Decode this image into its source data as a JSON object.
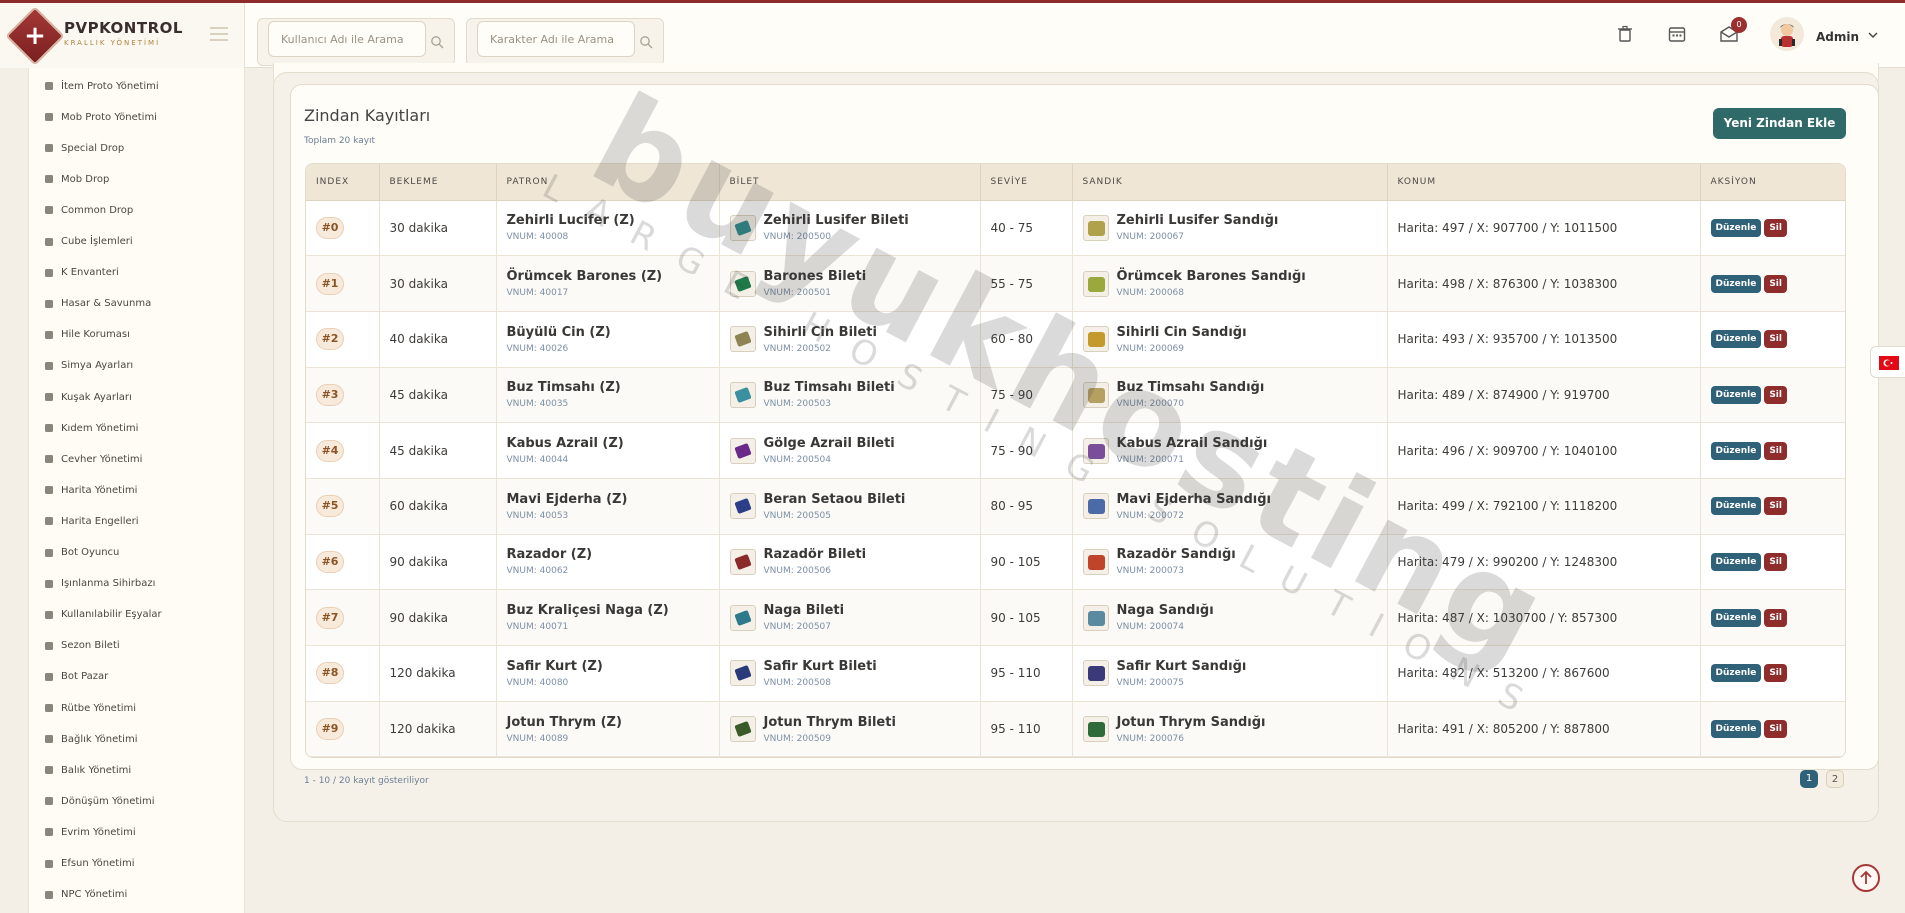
{
  "brand": {
    "name": "PVPKONTROL",
    "subtitle": "KRALLIK YÖNETİMİ",
    "logo_glyph": "+"
  },
  "header": {
    "search_user_placeholder": "Kullanıcı Adı ile Arama",
    "search_char_placeholder": "Karakter Adı ile Arama",
    "notification_count": "0",
    "user_name": "Admin"
  },
  "sidebar": {
    "items": [
      {
        "label": "İtem Proto Yönetimi",
        "icon": "box-icon"
      },
      {
        "label": "Mob Proto Yönetimi",
        "icon": "paw-icon"
      },
      {
        "label": "Special Drop",
        "icon": "gift-icon"
      },
      {
        "label": "Mob Drop",
        "icon": "bug-icon"
      },
      {
        "label": "Common Drop",
        "icon": "box-icon"
      },
      {
        "label": "Cube İşlemleri",
        "icon": "cube-icon"
      },
      {
        "label": "K Envanteri",
        "icon": "box-icon"
      },
      {
        "label": "Hasar & Savunma",
        "icon": "scale-icon"
      },
      {
        "label": "Hile Koruması",
        "icon": "shield-icon"
      },
      {
        "label": "Simya Ayarları",
        "icon": "gem-icon"
      },
      {
        "label": "Kuşak Ayarları",
        "icon": "sliders-icon"
      },
      {
        "label": "Kıdem Yönetimi",
        "icon": "star-icon"
      },
      {
        "label": "Cevher Yönetimi",
        "icon": "gem-icon"
      },
      {
        "label": "Harita Yönetimi",
        "icon": "map-icon"
      },
      {
        "label": "Harita Engelleri",
        "icon": "ban-icon"
      },
      {
        "label": "Bot Oyuncu",
        "icon": "robot-icon"
      },
      {
        "label": "Işınlanma Sihirbazı",
        "icon": "magic-icon"
      },
      {
        "label": "Kullanılabilir Eşyalar",
        "icon": "basket-icon"
      },
      {
        "label": "Sezon Bileti",
        "icon": "trophy-icon"
      },
      {
        "label": "Bot Pazar",
        "icon": "shop-icon"
      },
      {
        "label": "Rütbe Yönetimi",
        "icon": "star-icon"
      },
      {
        "label": "Bağlık Yönetimi",
        "icon": "h-icon"
      },
      {
        "label": "Balık Yönetimi",
        "icon": "anchor-icon"
      },
      {
        "label": "Dönüşüm Yönetimi",
        "icon": "shuffle-icon"
      },
      {
        "label": "Evrim Yönetimi",
        "icon": "wand-icon"
      },
      {
        "label": "Efsun Yönetimi",
        "icon": "wand-icon"
      },
      {
        "label": "NPC Yönetimi",
        "icon": "building-icon"
      }
    ]
  },
  "main": {
    "title": "Zindan Kayıtları",
    "subtitle": "Toplam 20 kayıt",
    "add_button": "Yeni Zindan Ekle",
    "footer": "1 - 10 / 20 kayıt gösteriliyor",
    "pages": [
      "1",
      "2"
    ],
    "edit_label": "Düzenle",
    "delete_label": "Sil",
    "columns": [
      "INDEX",
      "BEKLEME",
      "PATRON",
      "BİLET",
      "SEVİYE",
      "SANDIK",
      "KONUM",
      "AKSİYON"
    ],
    "rows": [
      {
        "index": "#0",
        "wait": "30 dakika",
        "boss": "Zehirli Lucifer (Z)",
        "boss_vnum": "VNUM: 40008",
        "ticket": "Zehirli Lusifer Bileti",
        "ticket_vnum": "VNUM: 200500",
        "level": "40 - 75",
        "chest": "Zehirli Lusifer Sandığı",
        "chest_vnum": "VNUM: 200067",
        "location": "Harita: 497 / X: 907700 / Y: 1011500",
        "ticket_color": "#2e8b8b",
        "chest_color": "#b0a24a"
      },
      {
        "index": "#1",
        "wait": "30 dakika",
        "boss": "Örümcek Barones (Z)",
        "boss_vnum": "VNUM: 40017",
        "ticket": "Barones Bileti",
        "ticket_vnum": "VNUM: 200501",
        "level": "55 - 75",
        "chest": "Örümcek Barones Sandığı",
        "chest_vnum": "VNUM: 200068",
        "location": "Harita: 498 / X: 876300 / Y: 1038300",
        "ticket_color": "#1f7a4a",
        "chest_color": "#9aa83c"
      },
      {
        "index": "#2",
        "wait": "40 dakika",
        "boss": "Büyülü Cin (Z)",
        "boss_vnum": "VNUM: 40026",
        "ticket": "Sihirli Cin Bileti",
        "ticket_vnum": "VNUM: 200502",
        "level": "60 - 80",
        "chest": "Sihirli Cin Sandığı",
        "chest_vnum": "VNUM: 200069",
        "location": "Harita: 493 / X: 935700 / Y: 1013500",
        "ticket_color": "#8e8352",
        "chest_color": "#c49a2c"
      },
      {
        "index": "#3",
        "wait": "45 dakika",
        "boss": "Buz Timsahı (Z)",
        "boss_vnum": "VNUM: 40035",
        "ticket": "Buz Timsahı Bileti",
        "ticket_vnum": "VNUM: 200503",
        "level": "75 - 90",
        "chest": "Buz Timsahı Sandığı",
        "chest_vnum": "VNUM: 200070",
        "location": "Harita: 489 / X: 874900 / Y: 919700",
        "ticket_color": "#3a8fa0",
        "chest_color": "#b5a060"
      },
      {
        "index": "#4",
        "wait": "45 dakika",
        "boss": "Kabus Azrail (Z)",
        "boss_vnum": "VNUM: 40044",
        "ticket": "Gölge Azrail Bileti",
        "ticket_vnum": "VNUM: 200504",
        "level": "75 - 90",
        "chest": "Kabus Azrail Sandığı",
        "chest_vnum": "VNUM: 200071",
        "location": "Harita: 496 / X: 909700 / Y: 1040100",
        "ticket_color": "#6a2a8a",
        "chest_color": "#7a4e9a"
      },
      {
        "index": "#5",
        "wait": "60 dakika",
        "boss": "Mavi Ejderha (Z)",
        "boss_vnum": "VNUM: 40053",
        "ticket": "Beran Setaou Bileti",
        "ticket_vnum": "VNUM: 200505",
        "level": "80 - 95",
        "chest": "Mavi Ejderha Sandığı",
        "chest_vnum": "VNUM: 200072",
        "location": "Harita: 499 / X: 792100 / Y: 1118200",
        "ticket_color": "#2c3e8a",
        "chest_color": "#4a6aa8"
      },
      {
        "index": "#6",
        "wait": "90 dakika",
        "boss": "Razador (Z)",
        "boss_vnum": "VNUM: 40062",
        "ticket": "Razadör Bileti",
        "ticket_vnum": "VNUM: 200506",
        "level": "90 - 105",
        "chest": "Razadör Sandığı",
        "chest_vnum": "VNUM: 200073",
        "location": "Harita: 479 / X: 990200 / Y: 1248300",
        "ticket_color": "#8a2a2a",
        "chest_color": "#c0442a"
      },
      {
        "index": "#7",
        "wait": "90 dakika",
        "boss": "Buz Kraliçesi Naga (Z)",
        "boss_vnum": "VNUM: 40071",
        "ticket": "Naga Bileti",
        "ticket_vnum": "VNUM: 200507",
        "level": "90 - 105",
        "chest": "Naga Sandığı",
        "chest_vnum": "VNUM: 200074",
        "location": "Harita: 487 / X: 1030700 / Y: 857300",
        "ticket_color": "#2e7a8a",
        "chest_color": "#5a8aa0"
      },
      {
        "index": "#8",
        "wait": "120 dakika",
        "boss": "Safir Kurt (Z)",
        "boss_vnum": "VNUM: 40080",
        "ticket": "Safir Kurt Bileti",
        "ticket_vnum": "VNUM: 200508",
        "level": "95 - 110",
        "chest": "Safir Kurt Sandığı",
        "chest_vnum": "VNUM: 200075",
        "location": "Harita: 482 / X: 513200 / Y: 867600",
        "ticket_color": "#2a3a7a",
        "chest_color": "#3a3a7a"
      },
      {
        "index": "#9",
        "wait": "120 dakika",
        "boss": "Jotun Thrym (Z)",
        "boss_vnum": "VNUM: 40089",
        "ticket": "Jotun Thrym Bileti",
        "ticket_vnum": "VNUM: 200509",
        "level": "95 - 110",
        "chest": "Jotun Thrym Sandığı",
        "chest_vnum": "VNUM: 200076",
        "location": "Harita: 491 / X: 805200 / Y: 887800",
        "ticket_color": "#3a5a2a",
        "chest_color": "#2f6a3a"
      }
    ]
  },
  "watermark": {
    "title": "buyukhosting",
    "subtitle": "LARGE HOSTING SOLUTIONS"
  },
  "colors": {
    "accent": "#8e2b2b",
    "primary_button": "#2f6a68",
    "edit_button": "#2f6178",
    "delete_button": "#8f2c2c"
  }
}
